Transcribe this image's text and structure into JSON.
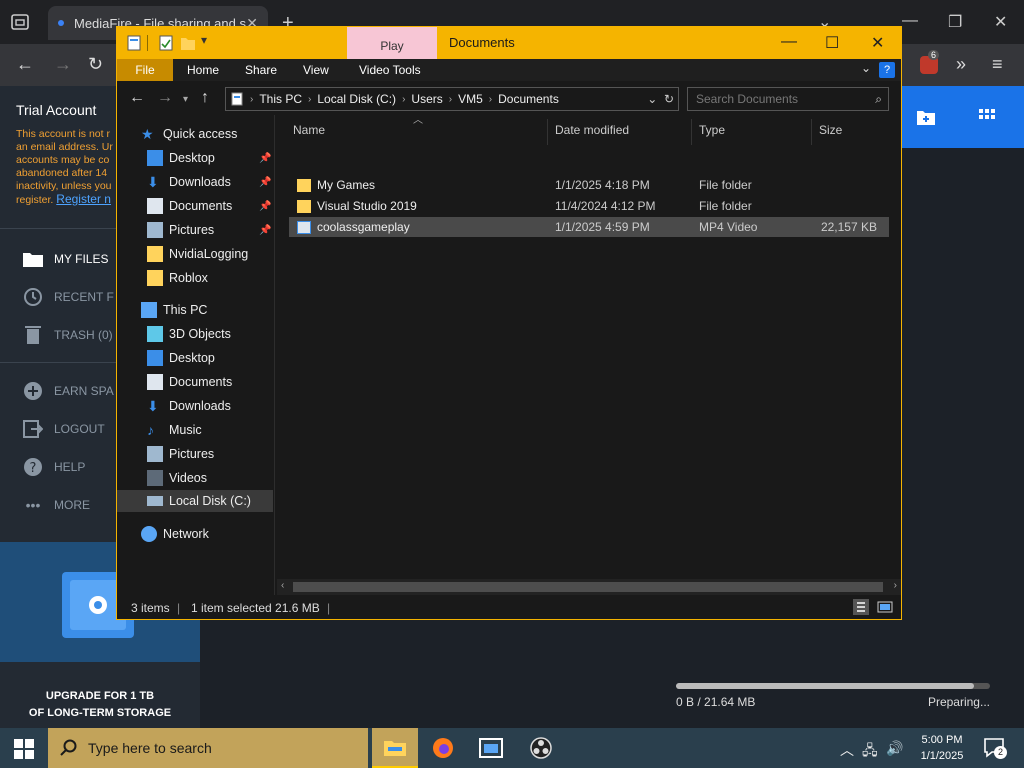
{
  "browser": {
    "tab_title": "MediaFire - File sharing and sto",
    "new_tab": "+",
    "extension_badge": "6"
  },
  "mediafire": {
    "trial_title": "Trial Account",
    "trial_lines": [
      "This account is not r",
      "an email address. Ur",
      "accounts may be co",
      "abandoned after 14",
      "inactivity, unless you",
      "register."
    ],
    "register_link": "Register n",
    "nav": [
      {
        "label": "MY FILES"
      },
      {
        "label": "RECENT F"
      },
      {
        "label": "TRASH (0)"
      },
      {
        "label": "EARN SPA"
      },
      {
        "label": "LOGOUT"
      },
      {
        "label": "HELP"
      },
      {
        "label": "MORE"
      }
    ],
    "upgrade_line1": "UPGRADE FOR 1 TB",
    "upgrade_line2": "OF LONG-TERM STORAGE",
    "upload": {
      "size": "0 B / 21.64 MB",
      "status": "Preparing...",
      "progress_fraction": 0.95
    }
  },
  "explorer": {
    "context_tab": "Play",
    "window_title": "Documents",
    "ribbon_tabs": [
      "File",
      "Home",
      "Share",
      "View",
      "Video Tools"
    ],
    "help": "?",
    "address_segments": [
      "This PC",
      "Local Disk (C:)",
      "Users",
      "VM5",
      "Documents"
    ],
    "search_placeholder": "Search Documents",
    "nav_pane": {
      "quick_access": "Quick access",
      "quick_items": [
        "Desktop",
        "Downloads",
        "Documents",
        "Pictures",
        "NvidiaLogging",
        "Roblox"
      ],
      "this_pc": "This PC",
      "pc_items": [
        "3D Objects",
        "Desktop",
        "Documents",
        "Downloads",
        "Music",
        "Pictures",
        "Videos",
        "Local Disk (C:)"
      ],
      "network": "Network"
    },
    "columns": [
      "Name",
      "Date modified",
      "Type",
      "Size"
    ],
    "files": [
      {
        "name": "My Games",
        "date": "1/1/2025 4:18 PM",
        "type": "File folder",
        "size": ""
      },
      {
        "name": "Visual Studio 2019",
        "date": "11/4/2024 4:12 PM",
        "type": "File folder",
        "size": ""
      },
      {
        "name": "coolassgameplay",
        "date": "1/1/2025 4:59 PM",
        "type": "MP4 Video",
        "size": "22,157 KB"
      }
    ],
    "status": {
      "items": "3 items",
      "selected": "1 item selected  21.6 MB"
    }
  },
  "taskbar": {
    "search_placeholder": "Type here to search",
    "clock_time": "5:00 PM",
    "clock_date": "1/1/2025",
    "notification_count": "2"
  },
  "colors": {
    "accent_yellow": "#f5b400",
    "mediafire_blue": "#1a73e8"
  }
}
